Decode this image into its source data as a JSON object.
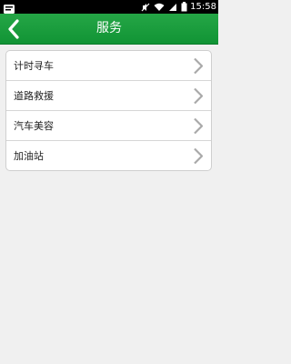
{
  "status_bar": {
    "time": "15:58",
    "icons": [
      "notification-icon",
      "mute-icon",
      "wifi-icon",
      "signal-icon",
      "battery-icon"
    ]
  },
  "header": {
    "title": "服务",
    "back_icon": "back-chevron-icon",
    "background": "#1a9c3d"
  },
  "menu": {
    "items": [
      {
        "label": "计时寻车",
        "icon": "chevron-right-icon"
      },
      {
        "label": "道路救援",
        "icon": "chevron-right-icon"
      },
      {
        "label": "汽车美容",
        "icon": "chevron-right-icon"
      },
      {
        "label": "加油站",
        "icon": "chevron-right-icon"
      }
    ]
  }
}
